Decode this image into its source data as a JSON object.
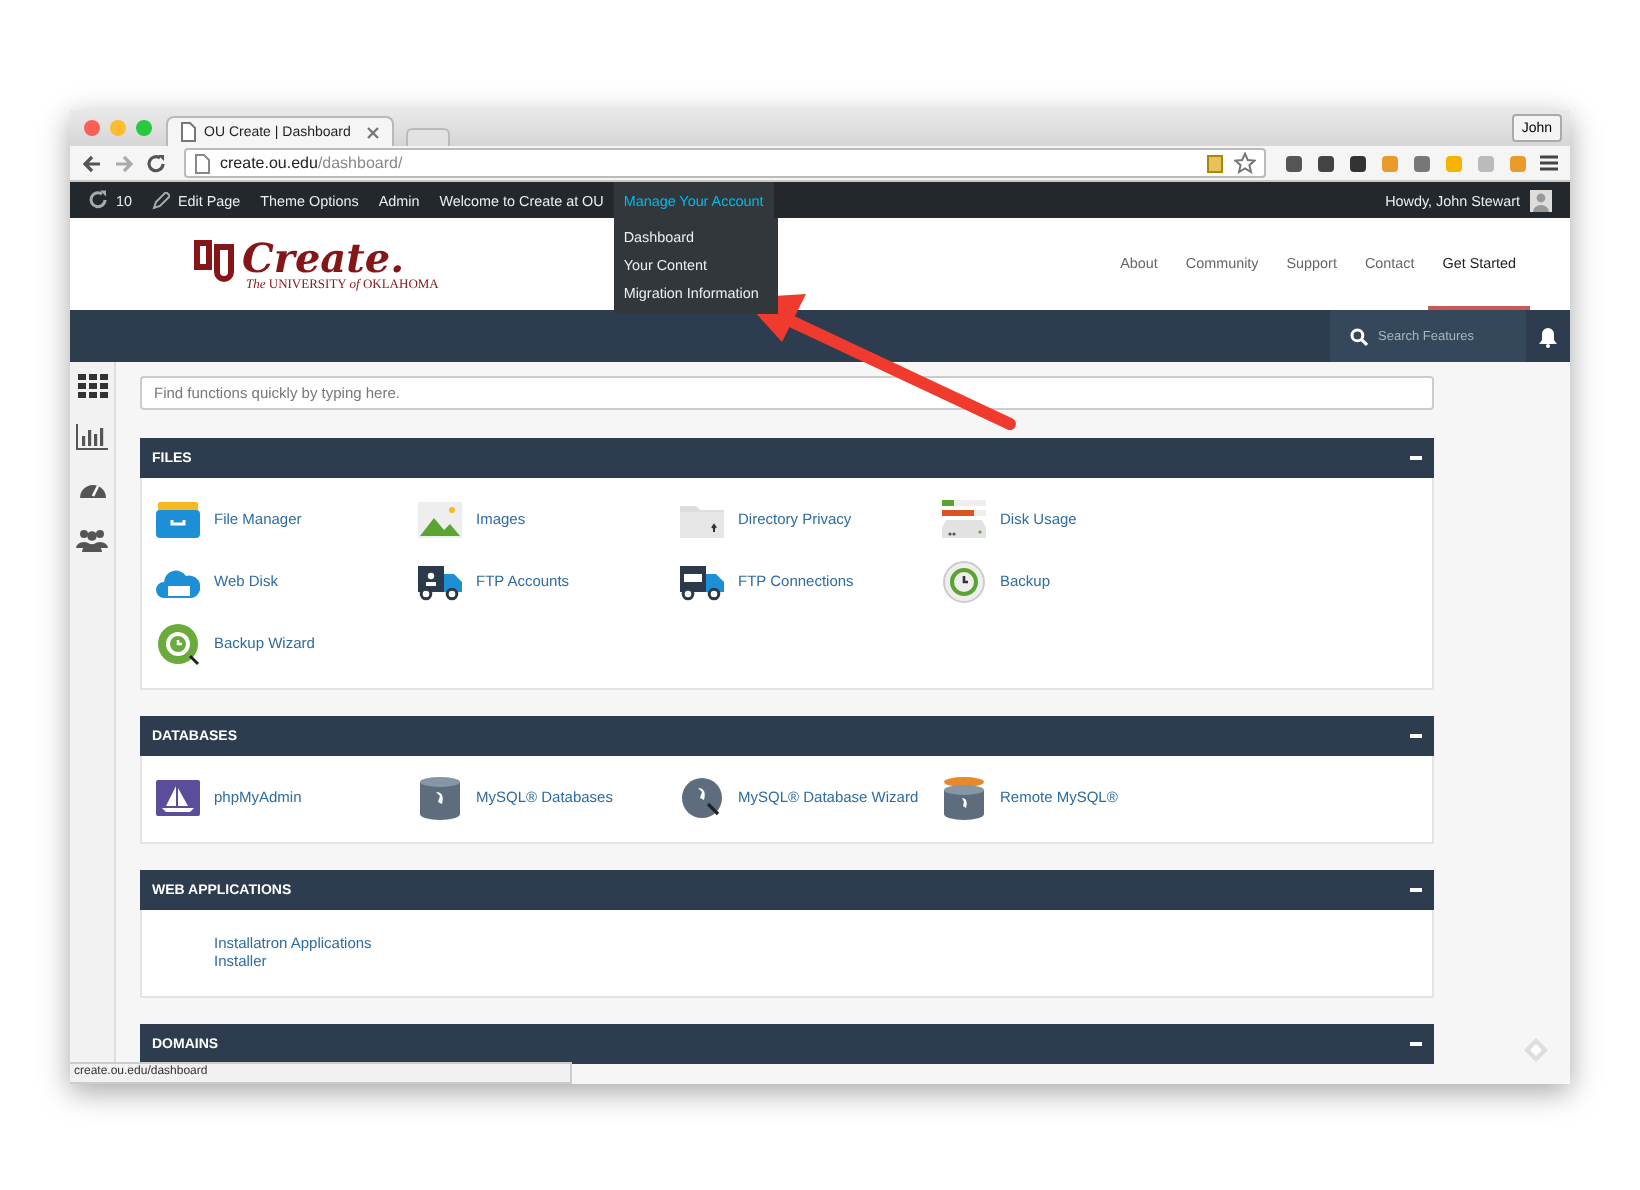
{
  "browser": {
    "tab_title": "OU Create | Dashboard",
    "profile": "John",
    "url": "**create.ou.edu**/dashboard/",
    "status": "create.ou.edu/dashboard"
  },
  "admin_bar": {
    "items": [
      {
        "kind": "updates",
        "label": "10",
        "expanded": false
      },
      {
        "kind": "edit",
        "label": "Edit Page",
        "expanded": false
      },
      {
        "kind": "text",
        "label": "Theme Options",
        "expanded": false
      },
      {
        "kind": "text",
        "label": "Admin",
        "expanded": false
      },
      {
        "kind": "text",
        "label": "Welcome to Create at OU",
        "expanded": false
      },
      {
        "kind": "text",
        "label": "Manage Your Account",
        "expanded": true,
        "submenu": [
          "Dashboard",
          "Your Content",
          "Migration Information"
        ]
      }
    ],
    "greeting": "Howdy, John Stewart"
  },
  "site_header": {
    "logo": {
      "title": "Create.",
      "subtitle": "*The* UNIVERSITY *of* OKLAHOMA"
    },
    "nav": [
      {
        "label": "About",
        "selected": false
      },
      {
        "label": "Community",
        "selected": false
      },
      {
        "label": "Support",
        "selected": false
      },
      {
        "label": "Contact",
        "selected": false
      },
      {
        "label": "Get Started",
        "selected": true
      }
    ]
  },
  "toolbar": {
    "search": {
      "placeholder": "Search Features"
    }
  },
  "main": {
    "search": {
      "placeholder": "Find functions quickly by typing here."
    },
    "sections": [
      {
        "title": "FILES",
        "expanded": true,
        "items": [
          {
            "kind": "file-manager",
            "label": "File Manager"
          },
          {
            "kind": "images",
            "label": "Images"
          },
          {
            "kind": "directory-privacy",
            "label": "Directory Privacy"
          },
          {
            "kind": "disk-usage",
            "label": "Disk Usage"
          },
          {
            "kind": "web-disk",
            "label": "Web Disk"
          },
          {
            "kind": "ftp-accounts",
            "label": "FTP Accounts"
          },
          {
            "kind": "ftp-connections",
            "label": "FTP Connections"
          },
          {
            "kind": "backup",
            "label": "Backup"
          },
          {
            "kind": "backup-wizard",
            "label": "Backup Wizard"
          }
        ]
      },
      {
        "title": "DATABASES",
        "expanded": true,
        "items": [
          {
            "kind": "phpmyadmin",
            "label": "phpMyAdmin"
          },
          {
            "kind": "mysql-databases",
            "label": "MySQL® Databases"
          },
          {
            "kind": "mysql-wizard",
            "label": "MySQL® Database Wizard"
          },
          {
            "kind": "remote-mysql",
            "label": "Remote MySQL®"
          }
        ]
      },
      {
        "title": "WEB APPLICATIONS",
        "expanded": true,
        "items": [
          {
            "kind": "blank",
            "label": "Installatron Applications Installer"
          }
        ]
      },
      {
        "title": "DOMAINS",
        "expanded": true
      }
    ]
  }
}
